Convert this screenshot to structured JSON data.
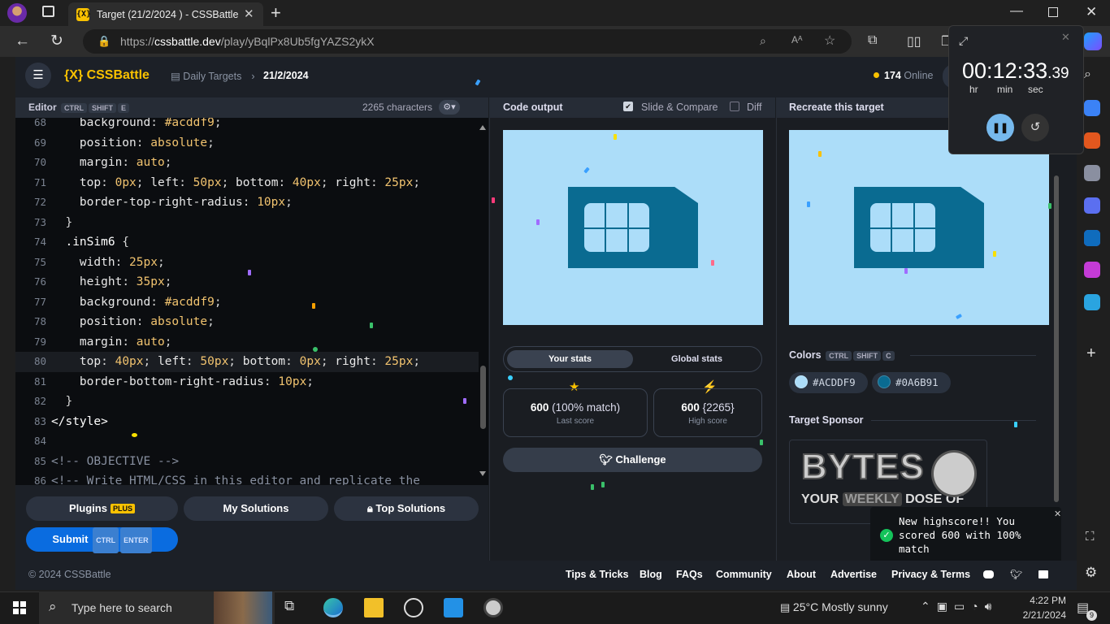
{
  "browser": {
    "tab_title": "Target (21/2/2024 ) - CSSBattle",
    "tab_favicon": "{X}",
    "url_prefix": "https://",
    "url_domain": "cssbattle.dev",
    "url_path": "/play/yBqlPx8Ub5fgYAZS2ykX"
  },
  "app": {
    "logo": "{X} CSSBattle",
    "breadcrumb_daily": "Daily Targets",
    "breadcrumb_date": "21/2/2024",
    "online_count": "174",
    "online_label": "Online"
  },
  "editor": {
    "label": "Editor",
    "kbd": [
      "CTRL",
      "SHIFT",
      "E"
    ],
    "char_count": "2265 characters",
    "lines": [
      {
        "n": "68",
        "code": "    background: #acddf9;"
      },
      {
        "n": "69",
        "code": "    position: absolute;"
      },
      {
        "n": "70",
        "code": "    margin: auto;"
      },
      {
        "n": "71",
        "code": "    top: 0px; left: 50px; bottom: 40px; right: 25px;"
      },
      {
        "n": "72",
        "code": "    border-top-right-radius: 10px;"
      },
      {
        "n": "73",
        "code": "  }"
      },
      {
        "n": "74",
        "code": "  .inSim6 {"
      },
      {
        "n": "75",
        "code": "    width: 25px;"
      },
      {
        "n": "76",
        "code": "    height: 35px;"
      },
      {
        "n": "77",
        "code": "    background: #acddf9;"
      },
      {
        "n": "78",
        "code": "    position: absolute;"
      },
      {
        "n": "79",
        "code": "    margin: auto;"
      },
      {
        "n": "80",
        "code": "    top: 40px; left: 50px; bottom: 0px; right: 25px;"
      },
      {
        "n": "81",
        "code": "    border-bottom-right-radius: 10px;"
      },
      {
        "n": "82",
        "code": "  }"
      },
      {
        "n": "83",
        "code": "</style>"
      },
      {
        "n": "84",
        "code": ""
      },
      {
        "n": "85",
        "code": "<!-- OBJECTIVE -->"
      },
      {
        "n": "86",
        "code": "<!-- Write HTML/CSS in this editor and replicate the"
      }
    ]
  },
  "buttons": {
    "plugins": "Plugins",
    "plus": "PLUS",
    "my_solutions": "My Solutions",
    "top_solutions": "Top Solutions",
    "submit": "Submit",
    "submit_kbd": [
      "CTRL",
      "ENTER"
    ]
  },
  "output": {
    "title": "Code output",
    "slide_compare": "Slide & Compare",
    "diff": "Diff",
    "tab_your": "Your stats",
    "tab_global": "Global stats",
    "last_score_val": "600",
    "last_score_match": "(100% match)",
    "last_score_label": "Last score",
    "high_score_val": "600",
    "high_score_chars": "{2265}",
    "high_score_label": "High score",
    "challenge": "Challenge"
  },
  "target": {
    "title": "Recreate this target",
    "colors_label": "Colors",
    "colors_kbd": [
      "CTRL",
      "SHIFT",
      "C"
    ],
    "color1": "#ACDDF9",
    "color2": "#0A6B91",
    "sponsor_label": "Target Sponsor",
    "sponsor_main": "BYTES",
    "sponsor_sub1": "YOUR",
    "sponsor_sub2": "WEEKLY",
    "sponsor_sub3": "DOSE OF"
  },
  "toast": {
    "message": "New highscore!! You scored 600 with 100% match"
  },
  "footer": {
    "copyright": "© 2024 CSSBattle",
    "links": [
      "Tips & Tricks",
      "Blog",
      "FAQs",
      "Community",
      "About",
      "Advertise",
      "Privacy & Terms"
    ]
  },
  "timer": {
    "hh": "00",
    "mm": "12",
    "ss": "33",
    "cs": ".39",
    "hr": "hr",
    "min": "min",
    "sec": "sec"
  },
  "taskbar": {
    "search_placeholder": "Type here to search",
    "weather": "25°C  Mostly sunny",
    "time": "4:22 PM",
    "date": "2/21/2024",
    "notif_count": "9"
  },
  "colors": {
    "accent": "#f9c100",
    "light": "#acddf9",
    "dark": "#0a6b91",
    "submit": "#0a6ce0"
  }
}
